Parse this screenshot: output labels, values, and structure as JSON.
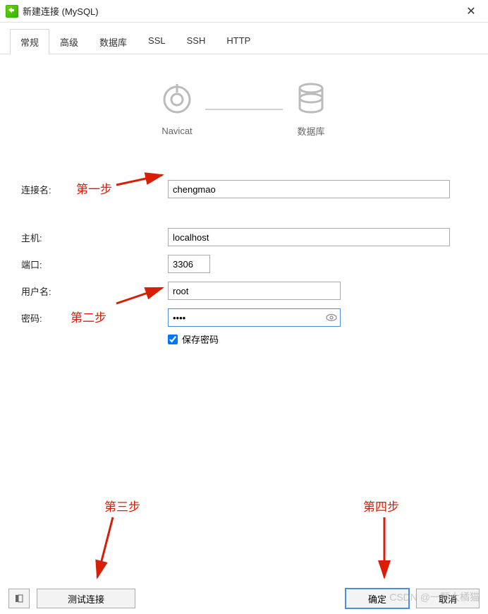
{
  "titlebar": {
    "title": "新建连接 (MySQL)"
  },
  "tabs": {
    "items": [
      {
        "label": "常规"
      },
      {
        "label": "高级"
      },
      {
        "label": "数据库"
      },
      {
        "label": "SSL"
      },
      {
        "label": "SSH"
      },
      {
        "label": "HTTP"
      }
    ]
  },
  "logos": {
    "left": "Navicat",
    "right": "数据库"
  },
  "form": {
    "conn_name_label": "连接名:",
    "conn_name_value": "chengmao",
    "host_label": "主机:",
    "host_value": "localhost",
    "port_label": "端口:",
    "port_value": "3306",
    "user_label": "用户名:",
    "user_value": "root",
    "pwd_label": "密码:",
    "pwd_value": "••••",
    "save_pwd_label": "保存密码"
  },
  "buttons": {
    "test": "测试连接",
    "ok": "确定",
    "cancel": "取消"
  },
  "annotations": {
    "step1": "第一步",
    "step2": "第二步",
    "step3": "第三步",
    "step4": "第四步"
  },
  "watermark": "CSDN @一颗大橘猫"
}
